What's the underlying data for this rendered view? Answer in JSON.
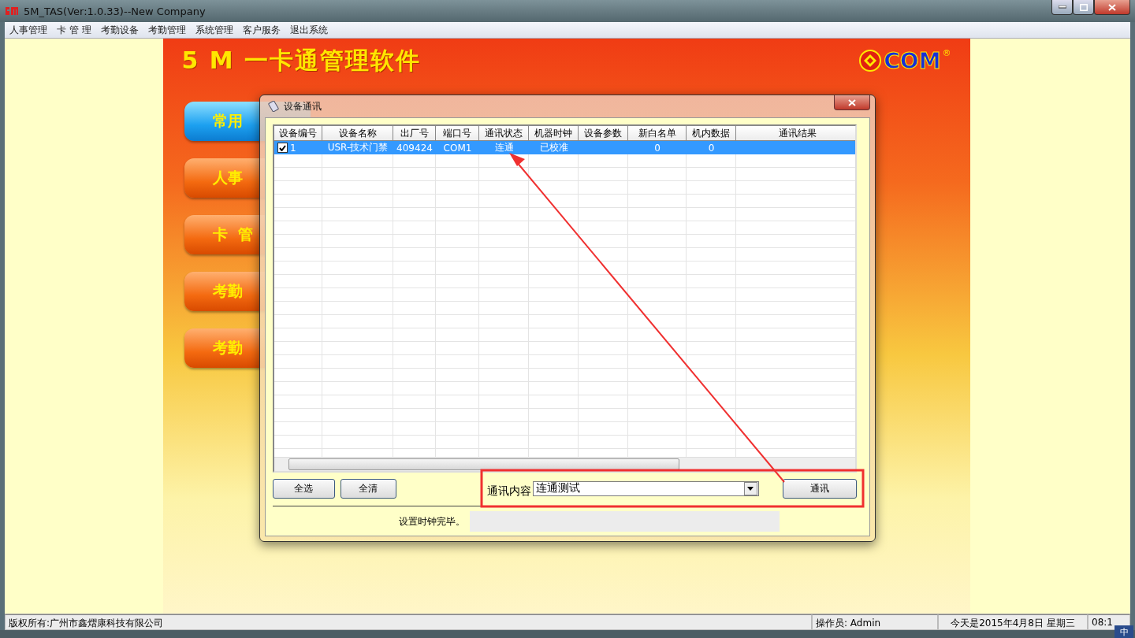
{
  "window": {
    "title": "5M_TAS(Ver:1.0.33)--New Company"
  },
  "menu": [
    "人事管理",
    "卡 管 理",
    "考勤设备",
    "考勤管理",
    "系统管理",
    "客户服务",
    "退出系统"
  ],
  "banner": {
    "title": "5 M 一卡通管理软件",
    "logo": "COM",
    "logo_mark": "®"
  },
  "side_buttons": [
    {
      "label": "常用",
      "selected": true
    },
    {
      "label": "人事",
      "selected": false
    },
    {
      "label": "卡  管",
      "selected": false
    },
    {
      "label": "考勤",
      "selected": false
    },
    {
      "label": "考勤",
      "selected": false
    }
  ],
  "dialog": {
    "title": "设备通讯",
    "table": {
      "columns": [
        "设备编号",
        "设备名称",
        "出厂号",
        "端口号",
        "通讯状态",
        "机器时钟",
        "设备参数",
        "新白名单",
        "机内数据",
        "通讯结果"
      ],
      "rows": [
        {
          "checked": true,
          "selected": true,
          "cells": [
            "1",
            "USR-技术门禁",
            "409424",
            "COM1",
            "连通",
            "已校准",
            null,
            "0",
            "0",
            null
          ]
        }
      ]
    },
    "buttons": [
      "全选",
      "全清"
    ],
    "content_label": "通讯内容",
    "content_select": {
      "value": "连通测试"
    },
    "action_button": "通讯",
    "status_message": "设置时钟完毕。"
  },
  "status_bar": {
    "copyright": "版权所有:广州市鑫熠康科技有限公司",
    "operator": "操作员: Admin",
    "date": "今天是2015年4月8日 星期三",
    "time": "08:1"
  },
  "ime": "中"
}
